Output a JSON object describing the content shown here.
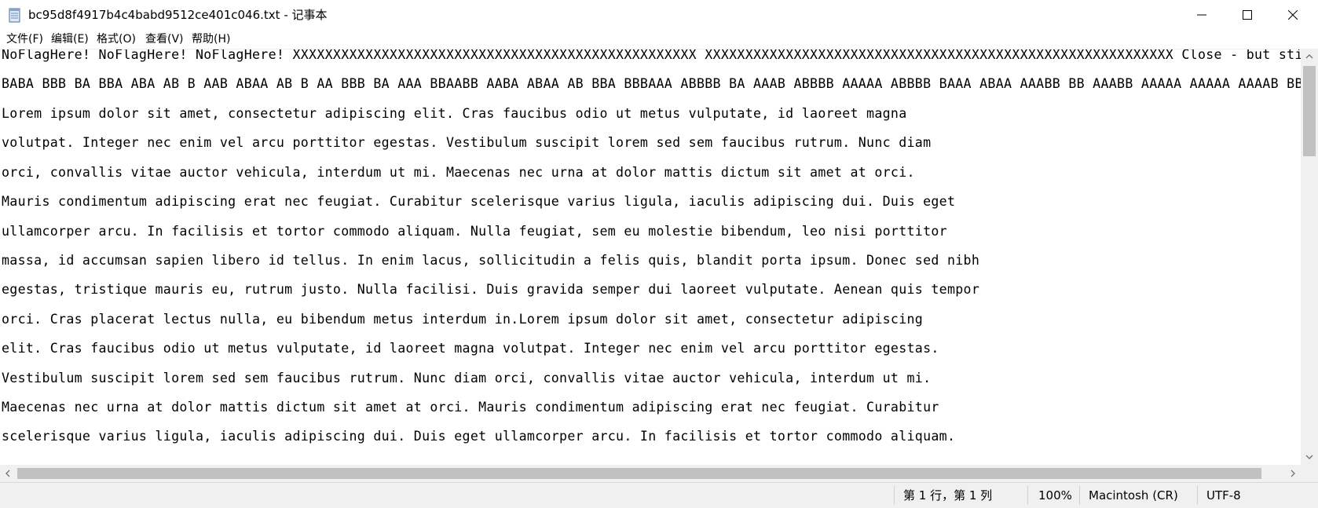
{
  "window": {
    "title": "bc95d8f4917b4c4babd9512ce401c046.txt - 记事本"
  },
  "menu": {
    "file": "文件(F)",
    "edit": "编辑(E)",
    "format": "格式(O)",
    "view": "查看(V)",
    "help": "帮助(H)"
  },
  "editor": {
    "lines": [
      "NoFlagHere! NoFlagHere! NoFlagHere! XXXXXXXXXXXXXXXXXXXXXXXXXXXXXXXXXXXXXXXXXXXXXXXXXX XXXXXXXXXXXXXXXXXXXXXXXXXXXXXXXXXXXXXXXXXXXXXXXXXXXXXXXXXX Close - but still not her",
      "BABA BBB BA BBA ABA AB B AAB ABAA AB B AA BBB BA AAA BBAABB AABA ABAA AB BBA BBBAAA ABBBB BA AAAB ABBBB AAAAA ABBBB BAAA ABAA AAABB BB AAABB AAAAA AAAAA AAAAB BBA AA",
      "Lorem ipsum dolor sit amet, consectetur adipiscing elit. Cras faucibus odio ut metus vulputate, id laoreet magna",
      "volutpat. Integer nec enim vel arcu porttitor egestas. Vestibulum suscipit lorem sed sem faucibus rutrum. Nunc diam",
      "orci, convallis vitae auctor vehicula, interdum ut mi. Maecenas nec urna at dolor mattis dictum sit amet at orci.",
      "Mauris condimentum adipiscing erat nec feugiat. Curabitur scelerisque varius ligula, iaculis adipiscing dui. Duis eget",
      "ullamcorper arcu. In facilisis et tortor commodo aliquam. Nulla feugiat, sem eu molestie bibendum, leo nisi porttitor",
      "massa, id accumsan sapien libero id tellus. In enim lacus, sollicitudin a felis quis, blandit porta ipsum. Donec sed nibh",
      "egestas, tristique mauris eu, rutrum justo. Nulla facilisi. Duis gravida semper dui laoreet vulputate. Aenean quis tempor",
      "orci. Cras placerat lectus nulla, eu bibendum metus interdum in.Lorem ipsum dolor sit amet, consectetur adipiscing",
      "elit. Cras faucibus odio ut metus vulputate, id laoreet magna volutpat. Integer nec enim vel arcu porttitor egestas.",
      "Vestibulum suscipit lorem sed sem faucibus rutrum. Nunc diam orci, convallis vitae auctor vehicula, interdum ut mi.",
      "Maecenas nec urna at dolor mattis dictum sit amet at orci. Mauris condimentum adipiscing erat nec feugiat. Curabitur",
      "scelerisque varius ligula, iaculis adipiscing dui. Duis eget ullamcorper arcu. In facilisis et tortor commodo aliquam."
    ]
  },
  "status": {
    "position": "第 1 行，第 1 列",
    "zoom": "100%",
    "line_ending": "Macintosh (CR)",
    "encoding": "UTF-8"
  }
}
